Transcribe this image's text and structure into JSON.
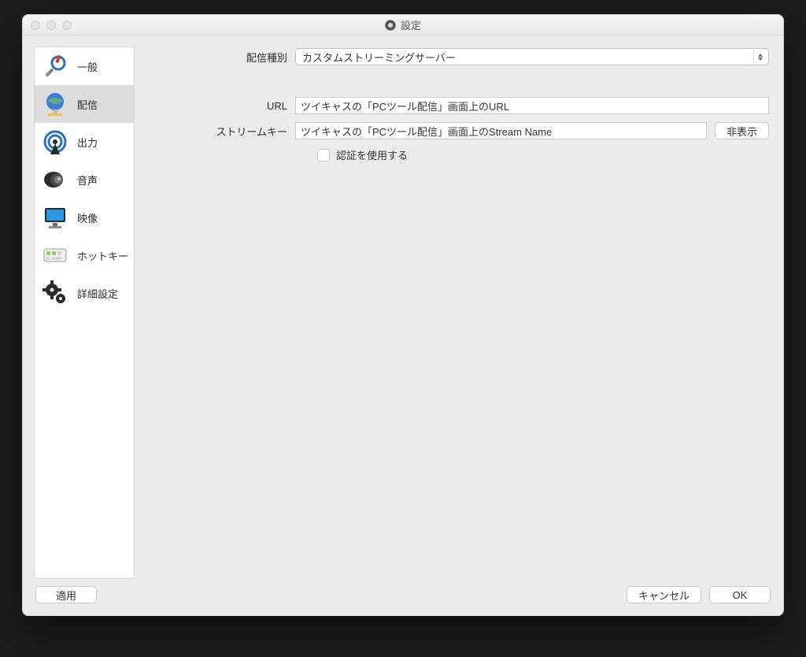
{
  "window": {
    "title": "設定"
  },
  "sidebar": {
    "items": [
      {
        "key": "general",
        "label": "一般"
      },
      {
        "key": "stream",
        "label": "配信"
      },
      {
        "key": "output",
        "label": "出力"
      },
      {
        "key": "audio",
        "label": "音声"
      },
      {
        "key": "video",
        "label": "映像"
      },
      {
        "key": "hotkeys",
        "label": "ホットキー"
      },
      {
        "key": "advanced",
        "label": "詳細設定"
      }
    ],
    "selected_key": "stream"
  },
  "form": {
    "service_label": "配信種別",
    "service_value": "カスタムストリーミングサーバー",
    "url_label": "URL",
    "url_value": "ツイキャスの「PCツール配信」画面上のURL",
    "key_label": "ストリームキー",
    "key_value": "ツイキャスの「PCツール配信」画面上のStream Name",
    "hide_button_label": "非表示",
    "auth_checkbox_label": "認証を使用する",
    "auth_checked": false
  },
  "buttons": {
    "apply": "適用",
    "cancel": "キャンセル",
    "ok": "OK"
  }
}
